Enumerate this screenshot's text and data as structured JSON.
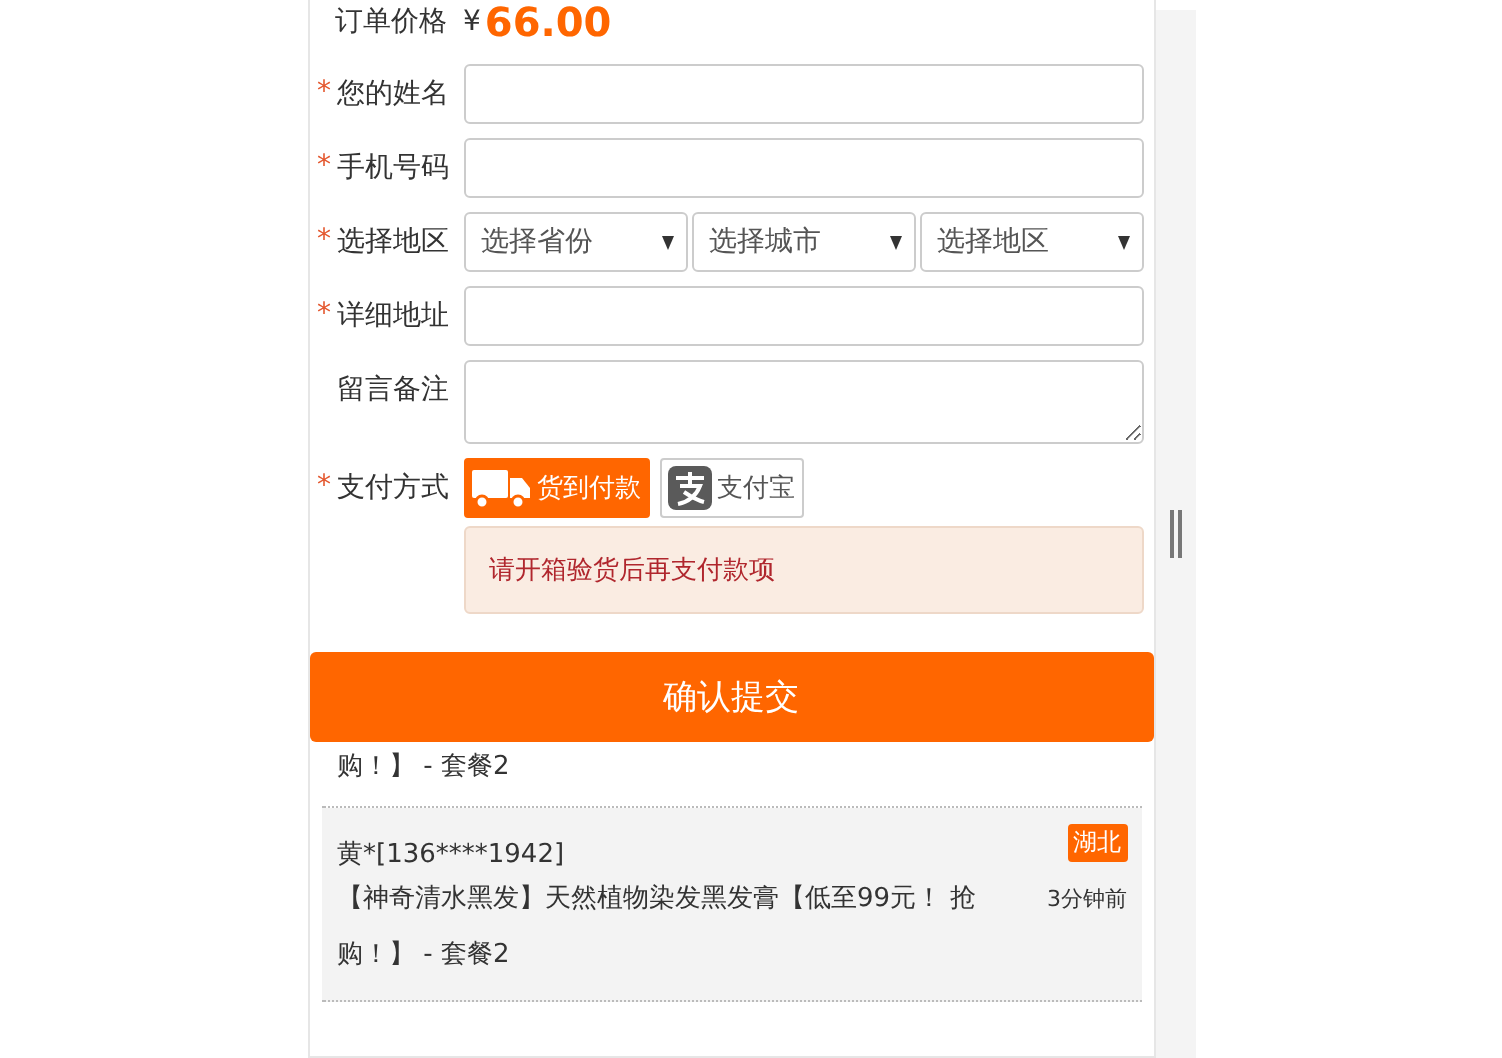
{
  "required_mark": "*",
  "price": {
    "label": "订单价格",
    "currency": "¥",
    "amount": "66.00"
  },
  "fields": [
    {
      "kind": "text",
      "label": "您的姓名",
      "required": true
    },
    {
      "kind": "text",
      "label": "手机号码",
      "required": true
    },
    {
      "kind": "selects",
      "label": "选择地区",
      "required": true,
      "options": [
        "选择省份",
        "选择城市",
        "选择地区"
      ]
    },
    {
      "kind": "text",
      "label": "详细地址",
      "required": true
    },
    {
      "kind": "textarea",
      "label": "留言备注",
      "required": false
    }
  ],
  "payment": {
    "label": "支付方式",
    "required": true,
    "methods": [
      {
        "kind": "truck",
        "label": "货到付款",
        "selected": true
      },
      {
        "kind": "alipay",
        "label": "支付宝",
        "selected": false
      }
    ],
    "notice": "请开箱验货后再支付款项"
  },
  "submit": "确认提交",
  "orders": [
    {
      "kind": "partial",
      "product": "购！】 - 套餐2"
    },
    {
      "kind": "full",
      "buyer": "黄*[136****1942]",
      "region": "湖北",
      "product": "【神奇清水黑发】天然植物染发黑发膏【低至99元！ 抢购！】 - 套餐2",
      "time": "3分钟前"
    }
  ]
}
